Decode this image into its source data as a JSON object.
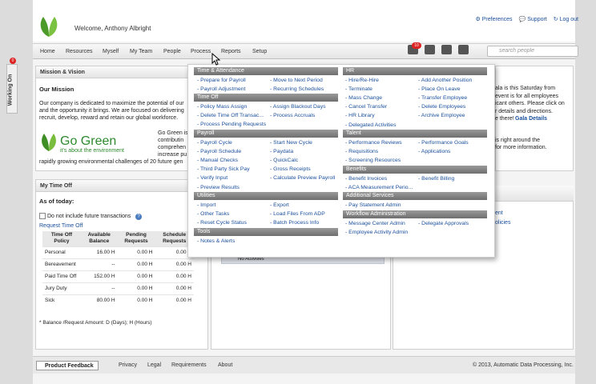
{
  "header": {
    "welcome": "Welcome, Anthony Albright",
    "preferences": "Preferences",
    "support": "Support",
    "logout": "Log out"
  },
  "nav": {
    "items": [
      "Home",
      "Resources",
      "Myself",
      "My Team",
      "People",
      "Process",
      "Reports",
      "Setup"
    ],
    "badge": "10",
    "search_placeholder": "search people"
  },
  "working_on": {
    "label": "Working On",
    "badge": "0"
  },
  "mission": {
    "title": "Mission & Vision",
    "heading": "Our Mission",
    "line1": "Our company is dedicated to maximize the potential of our",
    "line2": "and the opportunity it brings. We are focused on delivering",
    "line3": "recruit, develop, reward and retain our global workforce.",
    "gg1": "Go Green is",
    "gg2": "contributin",
    "gg3": "comprehen",
    "gg4": "increase pu",
    "gg5": "rapidly growing environmental challenges of 20 future gen",
    "logo_big": "Go Green",
    "logo_small": "it's about the environment"
  },
  "right_panel": {
    "l1": "ala is this Saturday from",
    "l2": "event is for all employees",
    "l3": "icant others. Please click on",
    "l4": "r details and directions.",
    "l5": "e there!",
    "gala": "Gala Details",
    "l6": "is right around the",
    "l7": "for more information.",
    "e1": "ent",
    "e2": "olicies"
  },
  "timeoff": {
    "title": "My Time Off",
    "as_of": "As of today:",
    "checkbox": "Do not include future transactions",
    "request": "Request Time Off",
    "headers": [
      "Time Off Policy",
      "Available Balance",
      "Pending Requests",
      "Schedule Requests"
    ],
    "rows": [
      [
        "Personal",
        "16.00 H",
        "0.00 H",
        "0.00 H"
      ],
      [
        "Bereavement",
        "--",
        "0.00 H",
        "0.00 H"
      ],
      [
        "Paid Time Off",
        "152.00 H",
        "0.00 H",
        "0.00 H"
      ],
      [
        "Jury Duty",
        "--",
        "0.00 H",
        "0.00 H"
      ],
      [
        "Sick",
        "80.00 H",
        "0.00 H",
        "0.00 H"
      ]
    ],
    "footnote": "* Balance /Request Amount: D (Days); H (Hours)"
  },
  "activities": "No Activities",
  "menu": {
    "ta": {
      "title": "Time & Attendance",
      "c1": [
        "Prepare for Payroll",
        "Payroll Adjustment"
      ],
      "c2": [
        "Move to Next Period",
        "Recurring Schedules"
      ]
    },
    "to": {
      "title": "Time Off",
      "c1": [
        "Policy Mass Assign",
        "Delete Time Off Transac...",
        "Process Pending Requests"
      ],
      "c2": [
        "Assign Blackout Days",
        "Process Accruals"
      ]
    },
    "pay": {
      "title": "Payroll",
      "c1": [
        "Payroll Cycle",
        "Payroll Schedule",
        "Manual Checks",
        "Third Party Sick Pay",
        "Verify Input",
        "Preview Results"
      ],
      "c2": [
        "Start New Cycle",
        "Paydata",
        "QuickCalc",
        "Gross Receipts",
        "Calculate Preview Payroll"
      ]
    },
    "util": {
      "title": "Utilities",
      "c1": [
        "Import",
        "Other Tasks",
        "Reset Cycle Status"
      ],
      "c2": [
        "Export",
        "Load Files From ADP",
        "Batch Process Info"
      ]
    },
    "tools": {
      "title": "Tools",
      "c1": [
        "Notes & Alerts"
      ]
    },
    "hr": {
      "title": "HR",
      "c1": [
        "Hire/Re-Hire",
        "Terminate",
        "Mass Change",
        "Cancel Transfer",
        "HR Library",
        "Delegated Activities"
      ],
      "c2": [
        "Add Another Position",
        "Place On Leave",
        "Transfer Employee",
        "Delete Employees",
        "Archive Employee"
      ]
    },
    "talent": {
      "title": "Talent",
      "c1": [
        "Performance Reviews",
        "Requisitions",
        "Screening Resources"
      ],
      "c2": [
        "Performance Goals",
        "Applications"
      ]
    },
    "ben": {
      "title": "Benefits",
      "c1": [
        "Benefit Invoices",
        "ACA Measurement Perio..."
      ],
      "c2": [
        "Benefit Billing"
      ]
    },
    "addl": {
      "title": "Additional Services",
      "c1": [
        "Pay Statement Admin"
      ]
    },
    "wf": {
      "title": "Workflow Administration",
      "c1": [
        "Message Center Admin",
        "Employee Activity Admin"
      ],
      "c2": [
        "Delegate Approvals"
      ]
    }
  },
  "footer": {
    "feedback": "Product Feedback",
    "links": [
      "Privacy",
      "Legal",
      "Requirements",
      "About"
    ],
    "copyright": "© 2013, Automatic Data Processing, Inc."
  }
}
